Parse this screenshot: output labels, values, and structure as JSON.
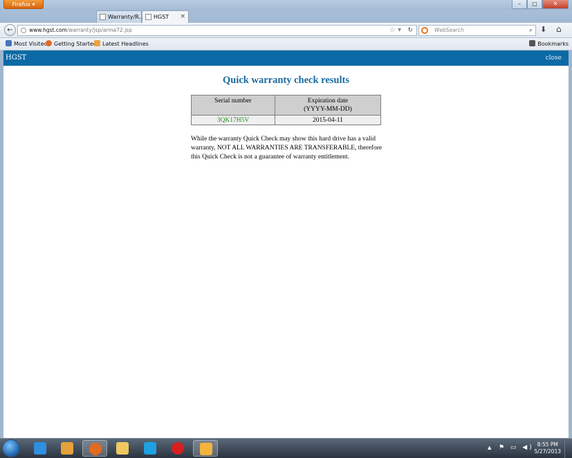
{
  "browser": {
    "menu_button": "Firefox",
    "window_controls": {
      "minimize": "–",
      "maximize": "□",
      "close": "✕"
    },
    "tabs": [
      {
        "label": "Warranty/R...",
        "active": false
      },
      {
        "label": "HGST",
        "active": true,
        "close": "×"
      }
    ],
    "url": {
      "host": "www.hgst.com",
      "path": "/warranty/jsp/arma72.jsp"
    },
    "search": {
      "placeholder": "WebSearch"
    },
    "bookmarks": [
      {
        "label": "Most Visited",
        "icon": "bookmark-icon"
      },
      {
        "label": "Getting Started",
        "icon": "firefox-icon"
      },
      {
        "label": "Latest Headlines",
        "icon": "rss-icon"
      }
    ],
    "bookmarks_menu": "Bookmarks"
  },
  "page": {
    "brand": "HGST",
    "close_label": "close",
    "heading": "Quick warranty check results",
    "table": {
      "headers": [
        "Serial number",
        "Expiration date",
        "(YYYY-MM-DD)"
      ],
      "rows": [
        {
          "serial": "3QK17H5V",
          "expiration": "2015-04-11"
        }
      ]
    },
    "notice": "While the warranty Quick Check may show this hard drive has a valid warranty, NOT ALL WARRANTIES ARE TRANSFERABLE, therefore this Quick Check is not a guarantee of warranty entitlement."
  },
  "taskbar": {
    "apps": [
      {
        "name": "internet-explorer-icon",
        "color": "#2f8fe0"
      },
      {
        "name": "media-player-icon",
        "color": "#e3a23a"
      },
      {
        "name": "firefox-icon",
        "color": "#e36b1f",
        "active": true
      },
      {
        "name": "file-explorer-icon",
        "color": "#f0c860"
      },
      {
        "name": "skype-icon",
        "color": "#1fa0e2"
      },
      {
        "name": "opera-icon",
        "color": "#d42020"
      },
      {
        "name": "paint-icon",
        "color": "#f3b33d",
        "active": true
      }
    ],
    "time": "8:55 PM",
    "date": "5/27/2013"
  }
}
